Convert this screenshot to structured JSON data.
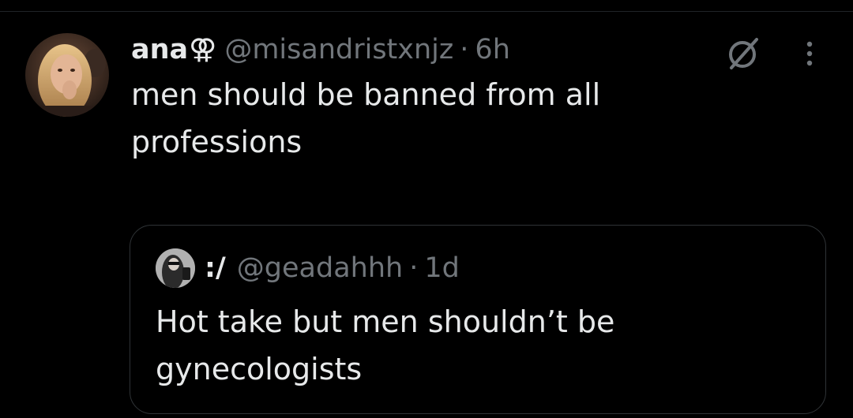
{
  "tweet": {
    "display_name": "ana",
    "name_emoji": "⚢",
    "handle": "@misandristxnjz",
    "separator": "·",
    "time": "6h",
    "text": "men should be banned from all professions",
    "avatar_icon": "profile-photo",
    "grok_icon": "grok-icon",
    "more_icon": "more-icon"
  },
  "quoted_tweet": {
    "display_name": ":/",
    "handle": "@geadahhh",
    "separator": "·",
    "time": "1d",
    "text": "Hot take but men shouldn’t be gynecologists",
    "avatar_icon": "profile-photo"
  },
  "colors": {
    "background": "#000000",
    "primary_text": "#e7e9ea",
    "secondary_text": "#71767b",
    "border": "#2f3336"
  }
}
